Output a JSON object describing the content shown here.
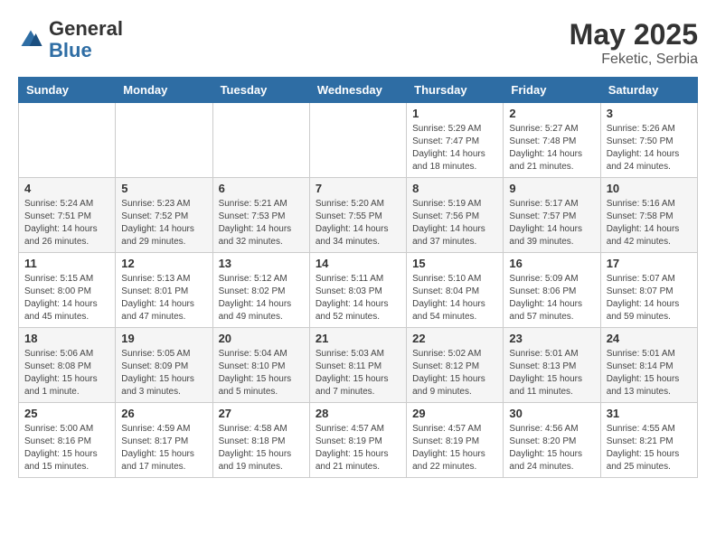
{
  "header": {
    "logo": {
      "general": "General",
      "blue": "Blue"
    },
    "title": "May 2025",
    "location": "Feketic, Serbia"
  },
  "weekdays": [
    "Sunday",
    "Monday",
    "Tuesday",
    "Wednesday",
    "Thursday",
    "Friday",
    "Saturday"
  ],
  "weeks": [
    [
      {
        "day": "",
        "info": ""
      },
      {
        "day": "",
        "info": ""
      },
      {
        "day": "",
        "info": ""
      },
      {
        "day": "",
        "info": ""
      },
      {
        "day": "1",
        "info": "Sunrise: 5:29 AM\nSunset: 7:47 PM\nDaylight: 14 hours\nand 18 minutes."
      },
      {
        "day": "2",
        "info": "Sunrise: 5:27 AM\nSunset: 7:48 PM\nDaylight: 14 hours\nand 21 minutes."
      },
      {
        "day": "3",
        "info": "Sunrise: 5:26 AM\nSunset: 7:50 PM\nDaylight: 14 hours\nand 24 minutes."
      }
    ],
    [
      {
        "day": "4",
        "info": "Sunrise: 5:24 AM\nSunset: 7:51 PM\nDaylight: 14 hours\nand 26 minutes."
      },
      {
        "day": "5",
        "info": "Sunrise: 5:23 AM\nSunset: 7:52 PM\nDaylight: 14 hours\nand 29 minutes."
      },
      {
        "day": "6",
        "info": "Sunrise: 5:21 AM\nSunset: 7:53 PM\nDaylight: 14 hours\nand 32 minutes."
      },
      {
        "day": "7",
        "info": "Sunrise: 5:20 AM\nSunset: 7:55 PM\nDaylight: 14 hours\nand 34 minutes."
      },
      {
        "day": "8",
        "info": "Sunrise: 5:19 AM\nSunset: 7:56 PM\nDaylight: 14 hours\nand 37 minutes."
      },
      {
        "day": "9",
        "info": "Sunrise: 5:17 AM\nSunset: 7:57 PM\nDaylight: 14 hours\nand 39 minutes."
      },
      {
        "day": "10",
        "info": "Sunrise: 5:16 AM\nSunset: 7:58 PM\nDaylight: 14 hours\nand 42 minutes."
      }
    ],
    [
      {
        "day": "11",
        "info": "Sunrise: 5:15 AM\nSunset: 8:00 PM\nDaylight: 14 hours\nand 45 minutes."
      },
      {
        "day": "12",
        "info": "Sunrise: 5:13 AM\nSunset: 8:01 PM\nDaylight: 14 hours\nand 47 minutes."
      },
      {
        "day": "13",
        "info": "Sunrise: 5:12 AM\nSunset: 8:02 PM\nDaylight: 14 hours\nand 49 minutes."
      },
      {
        "day": "14",
        "info": "Sunrise: 5:11 AM\nSunset: 8:03 PM\nDaylight: 14 hours\nand 52 minutes."
      },
      {
        "day": "15",
        "info": "Sunrise: 5:10 AM\nSunset: 8:04 PM\nDaylight: 14 hours\nand 54 minutes."
      },
      {
        "day": "16",
        "info": "Sunrise: 5:09 AM\nSunset: 8:06 PM\nDaylight: 14 hours\nand 57 minutes."
      },
      {
        "day": "17",
        "info": "Sunrise: 5:07 AM\nSunset: 8:07 PM\nDaylight: 14 hours\nand 59 minutes."
      }
    ],
    [
      {
        "day": "18",
        "info": "Sunrise: 5:06 AM\nSunset: 8:08 PM\nDaylight: 15 hours\nand 1 minute."
      },
      {
        "day": "19",
        "info": "Sunrise: 5:05 AM\nSunset: 8:09 PM\nDaylight: 15 hours\nand 3 minutes."
      },
      {
        "day": "20",
        "info": "Sunrise: 5:04 AM\nSunset: 8:10 PM\nDaylight: 15 hours\nand 5 minutes."
      },
      {
        "day": "21",
        "info": "Sunrise: 5:03 AM\nSunset: 8:11 PM\nDaylight: 15 hours\nand 7 minutes."
      },
      {
        "day": "22",
        "info": "Sunrise: 5:02 AM\nSunset: 8:12 PM\nDaylight: 15 hours\nand 9 minutes."
      },
      {
        "day": "23",
        "info": "Sunrise: 5:01 AM\nSunset: 8:13 PM\nDaylight: 15 hours\nand 11 minutes."
      },
      {
        "day": "24",
        "info": "Sunrise: 5:01 AM\nSunset: 8:14 PM\nDaylight: 15 hours\nand 13 minutes."
      }
    ],
    [
      {
        "day": "25",
        "info": "Sunrise: 5:00 AM\nSunset: 8:16 PM\nDaylight: 15 hours\nand 15 minutes."
      },
      {
        "day": "26",
        "info": "Sunrise: 4:59 AM\nSunset: 8:17 PM\nDaylight: 15 hours\nand 17 minutes."
      },
      {
        "day": "27",
        "info": "Sunrise: 4:58 AM\nSunset: 8:18 PM\nDaylight: 15 hours\nand 19 minutes."
      },
      {
        "day": "28",
        "info": "Sunrise: 4:57 AM\nSunset: 8:19 PM\nDaylight: 15 hours\nand 21 minutes."
      },
      {
        "day": "29",
        "info": "Sunrise: 4:57 AM\nSunset: 8:19 PM\nDaylight: 15 hours\nand 22 minutes."
      },
      {
        "day": "30",
        "info": "Sunrise: 4:56 AM\nSunset: 8:20 PM\nDaylight: 15 hours\nand 24 minutes."
      },
      {
        "day": "31",
        "info": "Sunrise: 4:55 AM\nSunset: 8:21 PM\nDaylight: 15 hours\nand 25 minutes."
      }
    ]
  ]
}
